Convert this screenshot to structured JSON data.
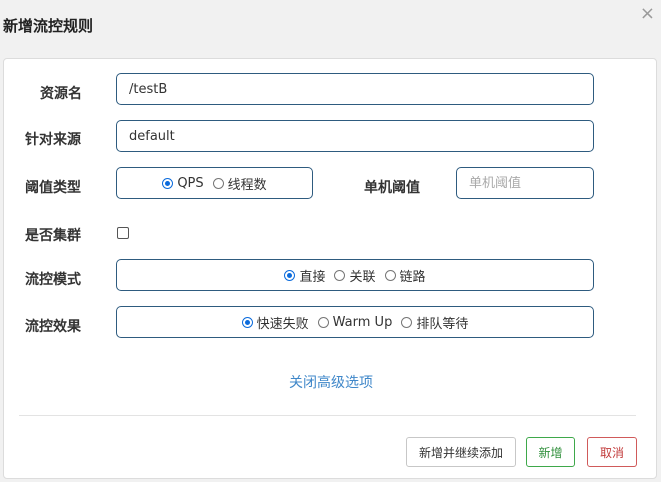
{
  "dialog": {
    "title": "新增流控规则",
    "close_symbol": "×"
  },
  "form": {
    "resource": {
      "label": "资源名",
      "value": "/testB"
    },
    "limit_app": {
      "label": "针对来源",
      "value": "default"
    },
    "threshold_type": {
      "label": "阈值类型",
      "options": [
        "QPS",
        "线程数"
      ],
      "selected": "QPS"
    },
    "single_threshold": {
      "label": "单机阈值",
      "placeholder": "单机阈值",
      "value": ""
    },
    "cluster": {
      "label": "是否集群",
      "checked": false
    },
    "strategy": {
      "label": "流控模式",
      "options": [
        "直接",
        "关联",
        "链路"
      ],
      "selected": "直接"
    },
    "control_behavior": {
      "label": "流控效果",
      "options": [
        "快速失败",
        "Warm Up",
        "排队等待"
      ],
      "selected": "快速失败"
    },
    "advanced_toggle": "关闭高级选项"
  },
  "buttons": {
    "save_and_continue": "新增并继续添加",
    "save": "新增",
    "cancel": "取消"
  }
}
